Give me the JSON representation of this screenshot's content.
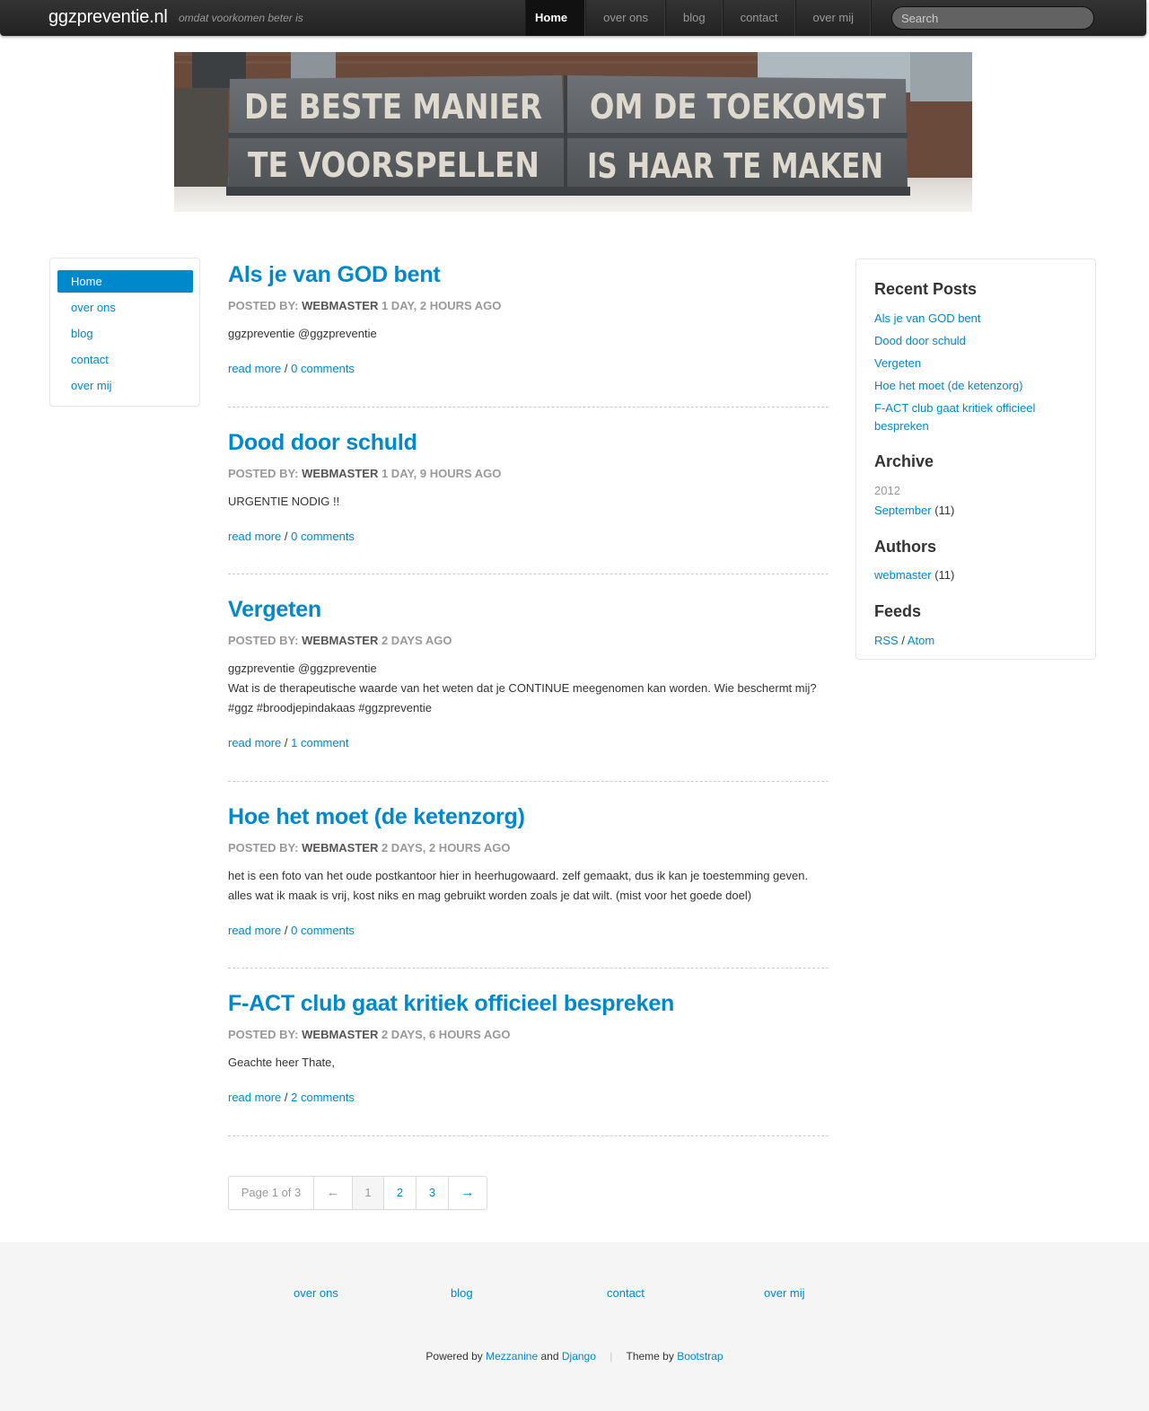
{
  "site": {
    "brand": "ggzpreventie.nl",
    "tagline": "omdat voorkomen beter is"
  },
  "nav": {
    "items": [
      {
        "label": "Home",
        "active": true
      },
      {
        "label": "over ons"
      },
      {
        "label": "blog"
      },
      {
        "label": "contact"
      },
      {
        "label": "over mij"
      }
    ],
    "search_placeholder": "Search"
  },
  "banner": {
    "lines": [
      "DE BESTE MANIER",
      "OM DE TOEKOMST",
      "TE VOORSPELLEN",
      "IS HAAR TE MAKEN"
    ]
  },
  "leftnav": {
    "items": [
      "Home",
      "over ons",
      "blog",
      "contact",
      "over mij"
    ]
  },
  "meta_prefix": "POSTED BY:",
  "read_more": "read more",
  "link_sep": "/",
  "posts": [
    {
      "title": "Als je van GOD bent",
      "author": "WEBMASTER",
      "age": "1 DAY, 2 HOURS AGO",
      "body": [
        "ggzpreventie @ggzpreventie"
      ],
      "comments": "0 comments"
    },
    {
      "title": "Dood door schuld",
      "author": "WEBMASTER",
      "age": "1 DAY, 9 HOURS AGO",
      "body": [
        "URGENTIE NODIG !!"
      ],
      "comments": "0 comments"
    },
    {
      "title": "Vergeten",
      "author": "WEBMASTER",
      "age": "2 DAYS AGO",
      "body": [
        "ggzpreventie @ggzpreventie",
        "Wat is de therapeutische waarde van het weten dat je CONTINUE meegenomen kan worden. Wie beschermt mij?",
        "#ggz #broodjepindakaas #ggzpreventie"
      ],
      "comments": "1 comment"
    },
    {
      "title": "Hoe het moet (de ketenzorg)",
      "author": "WEBMASTER",
      "age": "2 DAYS, 2 HOURS AGO",
      "body": [
        "het is een foto van het oude postkantoor hier in heerhugowaard. zelf gemaakt, dus ik kan je toestemming geven.",
        "alles wat ik maak is vrij, kost niks en mag gebruikt worden zoals je dat wilt. (mist voor het goede doel)"
      ],
      "comments": "0 comments"
    },
    {
      "title": "F-ACT club gaat kritiek officieel bespreken",
      "author": "WEBMASTER",
      "age": "2 DAYS, 6 HOURS AGO",
      "body": [
        "Geachte heer Thate,"
      ],
      "comments": "2 comments"
    }
  ],
  "pagination": {
    "info": "Page 1 of 3",
    "prev": "←",
    "pages": [
      "1",
      "2",
      "3"
    ],
    "next": "→"
  },
  "sidebar": {
    "recent_title": "Recent Posts",
    "recent": [
      "Als je van GOD bent",
      "Dood door schuld",
      "Vergeten",
      "Hoe het moet (de ketenzorg)",
      "F-ACT club gaat kritiek officieel bespreken"
    ],
    "archive_title": "Archive",
    "archive_year": "2012",
    "archive_month": "September",
    "archive_count": "(11)",
    "authors_title": "Authors",
    "author_name": "webmaster",
    "author_count": "(11)",
    "feeds_title": "Feeds",
    "rss": "RSS",
    "feed_sep": "/",
    "atom": "Atom"
  },
  "footer": {
    "links": [
      "over ons",
      "blog",
      "contact",
      "over mij"
    ],
    "powered_by": "Powered by",
    "mezzanine": "Mezzanine",
    "and": "and",
    "django": "Django",
    "bar": "|",
    "theme_by": "Theme by",
    "bootstrap": "Bootstrap"
  }
}
